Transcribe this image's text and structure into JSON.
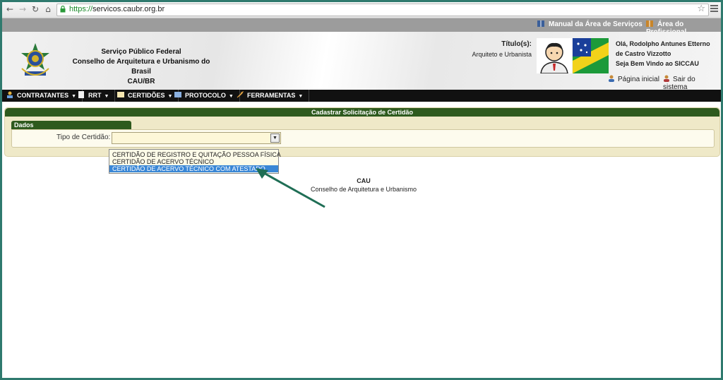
{
  "browser": {
    "url_protocol": "https://",
    "url_host": "servicos.caubr.org.br"
  },
  "toplinks": {
    "manual": "Manual da Área de Serviços",
    "profissional": "Área do Profissional"
  },
  "header": {
    "org_line1": "Serviço Público Federal",
    "org_line2": "Conselho de Arquitetura e Urbanismo do Brasil",
    "org_line3": "CAU/BR",
    "titulos_label": "Título(s):",
    "titulos_value": "Arquiteto e Urbanista",
    "greeting": "Olá, Rodolpho Antunes Etterno de Castro Vizzotto",
    "welcome": "Seja Bem Vindo ao SICCAU",
    "home_link": "Página inicial",
    "logout_link": "Sair do sistema"
  },
  "menu": {
    "items": [
      "CONTRATANTES",
      "RRT",
      "CERTIDÕES",
      "PROTOCOLO",
      "FERRAMENTAS"
    ]
  },
  "panel": {
    "title": "Cadastrar Solicitação de Certidão",
    "tab": "Dados",
    "field_label": "Tipo de Certidão:",
    "select_value": ""
  },
  "dropdown": {
    "options": [
      "CERTIDÃO DE REGISTRO E QUITAÇÃO PESSOA FÍSICA",
      "CERTIDÃO DE ACERVO TÉCNICO",
      "CERTIDÃO DE ACERVO TÉCNICO COM ATESTADO"
    ],
    "highlighted_index": 2
  },
  "footer": {
    "line1": "CAU",
    "line2": "Conselho de Arquitetura e Urbanismo"
  },
  "colors": {
    "frame": "#2f7a6e",
    "panel_header": "#2e5a1e",
    "panel_bg": "#efe9c8",
    "menu_bg": "#111111",
    "highlight": "#3a87d6",
    "annotation_arrow": "#1f6e55"
  },
  "icons": [
    "back-icon",
    "forward-icon",
    "reload-icon",
    "home-icon",
    "lock-icon",
    "star-icon",
    "menu-icon",
    "book-icon",
    "person-icon",
    "exit-icon"
  ]
}
